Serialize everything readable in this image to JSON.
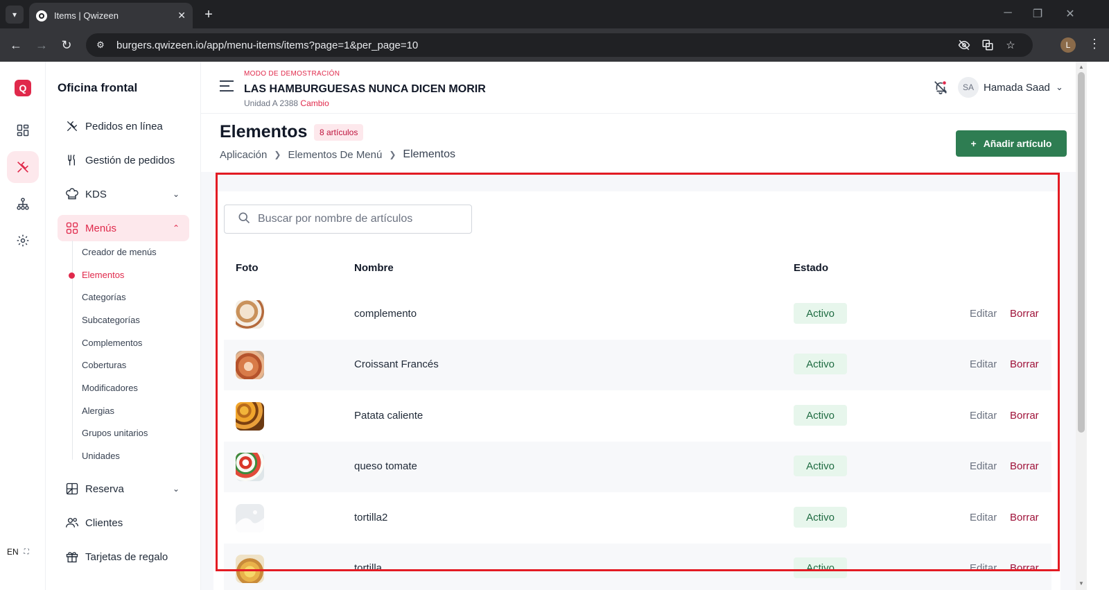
{
  "browser": {
    "tab_title": "Items | Qwizeen",
    "url": "burgers.qwizeen.io/app/menu-items/items?page=1&per_page=10",
    "profile_initial": "L"
  },
  "rail": {
    "logo_letter": "Q",
    "language": "EN"
  },
  "sidebar": {
    "title": "Oficina frontal",
    "items": [
      {
        "label": "Pedidos en línea",
        "icon": "fork-knife-cross-icon"
      },
      {
        "label": "Gestión de pedidos",
        "icon": "utensils-icon"
      },
      {
        "label": "KDS",
        "icon": "chef-hat-icon"
      },
      {
        "label": "Menús",
        "icon": "grid-icon"
      },
      {
        "label": "Reserva",
        "icon": "table-icon"
      },
      {
        "label": "Clientes",
        "icon": "users-icon"
      },
      {
        "label": "Tarjetas de regalo",
        "icon": "gift-icon"
      }
    ],
    "sub_items": [
      "Creador de menús",
      "Elementos",
      "Categorías",
      "Subcategorías",
      "Complementos",
      "Coberturas",
      "Modificadores",
      "Alergias",
      "Grupos unitarios",
      "Unidades"
    ]
  },
  "header": {
    "demo_label": "MODO DE DEMOSTRACIÓN",
    "restaurant_name": "LAS HAMBURGUESAS NUNCA DICEN MORIR",
    "unit_text": "Unidad A 2388",
    "change_link": "Cambio",
    "avatar_initials": "SA",
    "user_name": "Hamada Saad"
  },
  "page": {
    "title": "Elementos",
    "count_badge": "8 artículos",
    "breadcrumb": [
      "Aplicación",
      "Elementos De Menú",
      "Elementos"
    ],
    "add_button": "Añadir artículo"
  },
  "search": {
    "placeholder": "Buscar por nombre de artículos"
  },
  "table": {
    "headers": {
      "photo": "Foto",
      "name": "Nombre",
      "status": "Estado"
    },
    "edit_label": "Editar",
    "delete_label": "Borrar",
    "rows": [
      {
        "name": "complemento",
        "status": "Activo",
        "photo": "dessert"
      },
      {
        "name": "Croissant Francés",
        "status": "Activo",
        "photo": "croissant"
      },
      {
        "name": "Patata caliente",
        "status": "Activo",
        "photo": "potato"
      },
      {
        "name": "queso tomate",
        "status": "Activo",
        "photo": "caprese"
      },
      {
        "name": "tortilla2",
        "status": "Activo",
        "photo": "placeholder"
      },
      {
        "name": "tortilla",
        "status": "Activo",
        "photo": "tortilla"
      }
    ]
  },
  "colors": {
    "accent": "#e0294b",
    "primary_button": "#2e7d52",
    "status_bg": "#e7f6ec",
    "highlight_border": "#e31b23"
  }
}
